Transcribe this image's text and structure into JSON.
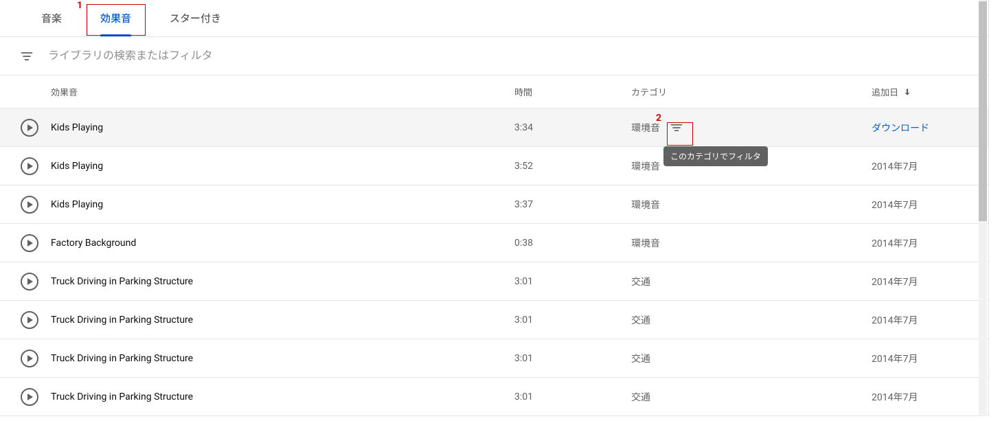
{
  "annotations": {
    "one": "1",
    "two": "2"
  },
  "tabs": {
    "music": "音楽",
    "sfx": "効果音",
    "starred": "スター付き"
  },
  "search": {
    "placeholder": "ライブラリの検索またはフィルタ"
  },
  "columns": {
    "title": "効果音",
    "duration": "時間",
    "category": "カテゴリ",
    "date": "追加日"
  },
  "tooltip": "このカテゴリでフィルタ",
  "download": "ダウンロード",
  "rows": [
    {
      "title": "Kids Playing",
      "duration": "3:34",
      "category": "環境音",
      "date": "",
      "active": true,
      "showFilter": true,
      "showTooltip": true
    },
    {
      "title": "Kids Playing",
      "duration": "3:52",
      "category": "環境音",
      "date": "2014年7月"
    },
    {
      "title": "Kids Playing",
      "duration": "3:37",
      "category": "環境音",
      "date": "2014年7月"
    },
    {
      "title": "Factory Background",
      "duration": "0:38",
      "category": "環境音",
      "date": "2014年7月"
    },
    {
      "title": "Truck Driving in Parking Structure",
      "duration": "3:01",
      "category": "交通",
      "date": "2014年7月"
    },
    {
      "title": "Truck Driving in Parking Structure",
      "duration": "3:01",
      "category": "交通",
      "date": "2014年7月"
    },
    {
      "title": "Truck Driving in Parking Structure",
      "duration": "3:01",
      "category": "交通",
      "date": "2014年7月"
    },
    {
      "title": "Truck Driving in Parking Structure",
      "duration": "3:01",
      "category": "交通",
      "date": "2014年7月"
    }
  ]
}
